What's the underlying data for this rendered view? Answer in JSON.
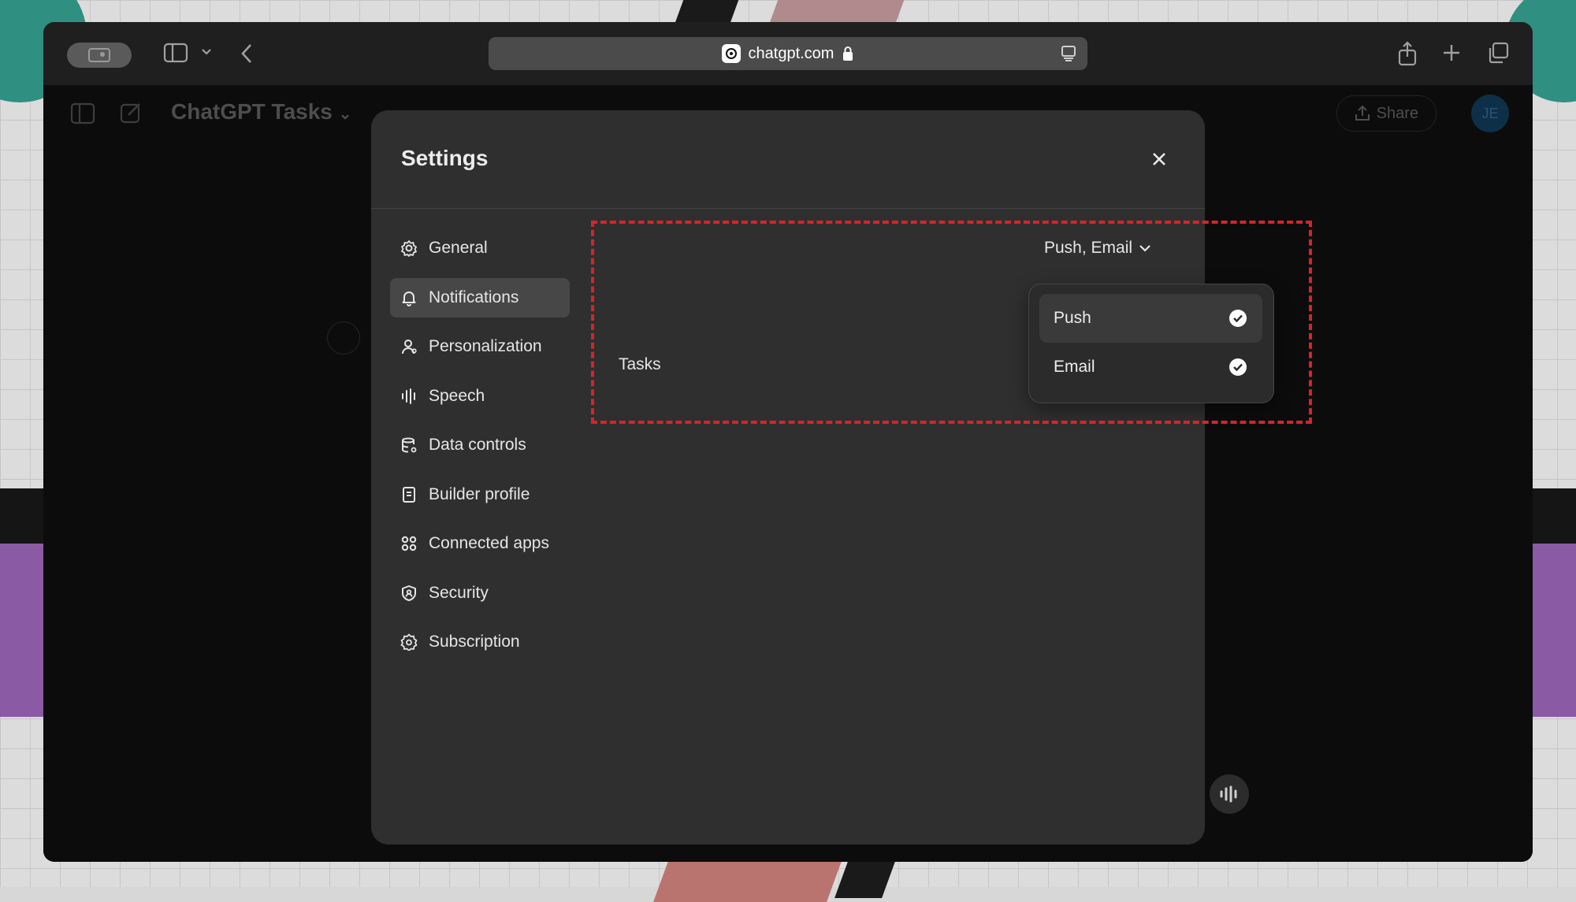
{
  "browser": {
    "url": "chatgpt.com"
  },
  "page": {
    "title": "ChatGPT Tasks",
    "share_label": "Share",
    "avatar_initials": "JE"
  },
  "modal": {
    "title": "Settings",
    "sidebar": [
      {
        "label": "General",
        "icon": "gear-icon"
      },
      {
        "label": "Notifications",
        "icon": "bell-icon",
        "active": true
      },
      {
        "label": "Personalization",
        "icon": "person-icon"
      },
      {
        "label": "Speech",
        "icon": "waveform-icon"
      },
      {
        "label": "Data controls",
        "icon": "database-icon"
      },
      {
        "label": "Builder profile",
        "icon": "id-card-icon"
      },
      {
        "label": "Connected apps",
        "icon": "grid-icon"
      },
      {
        "label": "Security",
        "icon": "shield-icon"
      },
      {
        "label": "Subscription",
        "icon": "badge-icon"
      }
    ],
    "tasks": {
      "label": "Tasks",
      "selected_value": "Push, Email",
      "options": [
        {
          "label": "Push",
          "checked": true
        },
        {
          "label": "Email",
          "checked": true
        }
      ]
    }
  },
  "colors": {
    "modal_bg": "#2f2f2f",
    "active_item_bg": "#474747",
    "highlight": "#d4252a"
  }
}
